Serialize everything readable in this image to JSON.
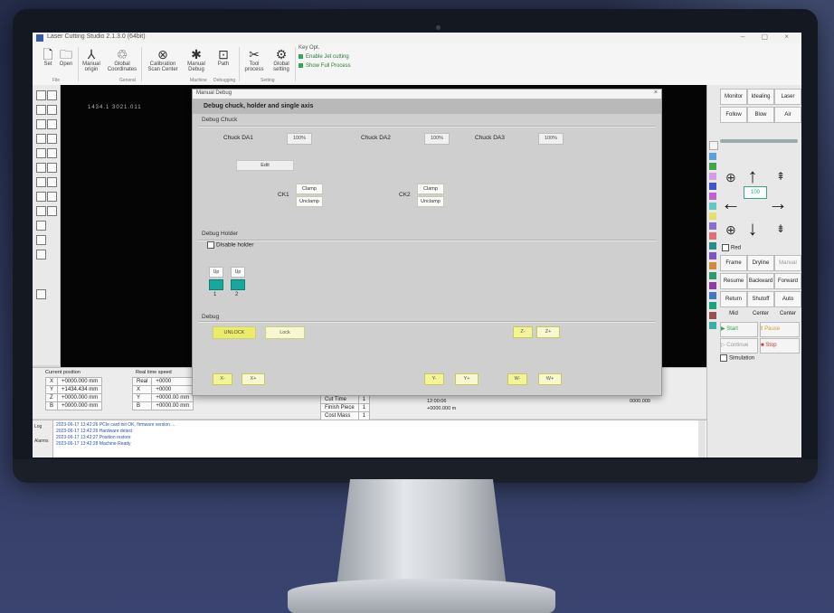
{
  "window": {
    "title": "Laser Cutting Studio 2.1.3.0 (64bit)"
  },
  "ribbon": {
    "buttons": [
      {
        "label": "Set",
        "icon": "file-icon"
      },
      {
        "label": "Open",
        "icon": "folder-icon"
      },
      {
        "label": "Manual origin",
        "icon": "origin-icon"
      },
      {
        "label": "Global Coordinates",
        "icon": "coordinates-icon"
      },
      {
        "label": "Calibration Scan Center",
        "icon": "target-icon"
      },
      {
        "label": "Manual Debug",
        "icon": "pin-icon"
      },
      {
        "label": "Path",
        "icon": "path-icon"
      },
      {
        "label": "Tool process",
        "icon": "tool-icon"
      },
      {
        "label": "Global setting",
        "icon": "gear-icon"
      }
    ],
    "groups": [
      "File",
      "General",
      "Machine",
      "Debugging",
      "Setting"
    ],
    "options_title": "Key Opt.",
    "options": [
      "Enable Jet cutting",
      "Show Full Process"
    ]
  },
  "canvas": {
    "coord_readout": "1434.1  3021.011"
  },
  "dialog": {
    "title": "Manual Debug",
    "header": "Debug chuck, holder and single axis",
    "section_chuck": "Debug Chuck",
    "chuck_labels": [
      "Chuck DA1",
      "Chuck DA2",
      "Chuck DA3"
    ],
    "chuck_values": [
      "100%",
      "100%",
      "100%"
    ],
    "edit_label": "Edit",
    "ck1_label": "CK1",
    "ck2_label": "CK2",
    "clamp_label": "Clamp",
    "unclamp_label": "Unclamp",
    "section_holder": "Debug Holder",
    "disable_holder": "Disable holder",
    "holder_buttons": [
      "Up",
      "Up"
    ],
    "holder_numbers": [
      "1",
      "2"
    ],
    "section_debug": "Debug",
    "unlock": "UNLOCK",
    "lock": "Lock",
    "axis_buttons_right": [
      "Z-",
      "Z+"
    ],
    "bottom_buttons": [
      "X-",
      "X+",
      "Y-",
      "Y+",
      "W-",
      "W+"
    ]
  },
  "right_panel": {
    "top_buttons": [
      "Monitor",
      "Idealing",
      "Laser",
      "Follow",
      "Blow",
      "Air"
    ],
    "step_value": "100",
    "checkbox_label": "Red",
    "actions": [
      "Frame",
      "Dryline",
      "Manual",
      "Resume",
      "Backward",
      "Forward",
      "Return Mid",
      "Shutoff Center",
      "Auto Center"
    ],
    "start": "Start",
    "pause": "Pause",
    "continue": "Continue",
    "stop": "Stop",
    "simulation": "Simulation"
  },
  "position_panel": {
    "title": "Current position",
    "rows": [
      {
        "axis": "X",
        "value": "+0000.000 mm"
      },
      {
        "axis": "Y",
        "value": "+1434.434 mm"
      },
      {
        "axis": "Z",
        "value": "+0000.000 mm"
      },
      {
        "axis": "B",
        "value": "+0000.000 mm"
      }
    ],
    "second_title": "Real time speed",
    "second_rows": [
      {
        "axis": "Real",
        "value": "+0000"
      },
      {
        "axis": "X",
        "value": "+0000"
      },
      {
        "axis": "Y",
        "value": "+0000.00 mm"
      },
      {
        "axis": "B",
        "value": "+0000.00 mm"
      }
    ],
    "extra": [
      "Cut Time",
      "Finish Piece",
      "Cost Mass"
    ],
    "extra_values": [
      "1",
      "1",
      "1"
    ],
    "speed_label": "Delay",
    "speed_value": "3000 °C",
    "counter_value": "12:00:06",
    "counter_value2": "+0000.000 m",
    "far_value": "0000.000"
  },
  "log": {
    "tabs": [
      "Log",
      "Alarms"
    ],
    "lines": [
      "2023-06-17 13:42:26 PCIe card init OK, firmware version ...",
      "2023-06-17 13:42:26 Hardware detect",
      "2023-06-17 13:42:27 Position restore",
      "2023-06-17 13:42:28 Machine Ready"
    ]
  },
  "colors": {
    "teal": "#16a89c",
    "yellow_button": "#f3f39a",
    "green_start": "#2fa84f",
    "stop_red": "#d32f2f"
  }
}
